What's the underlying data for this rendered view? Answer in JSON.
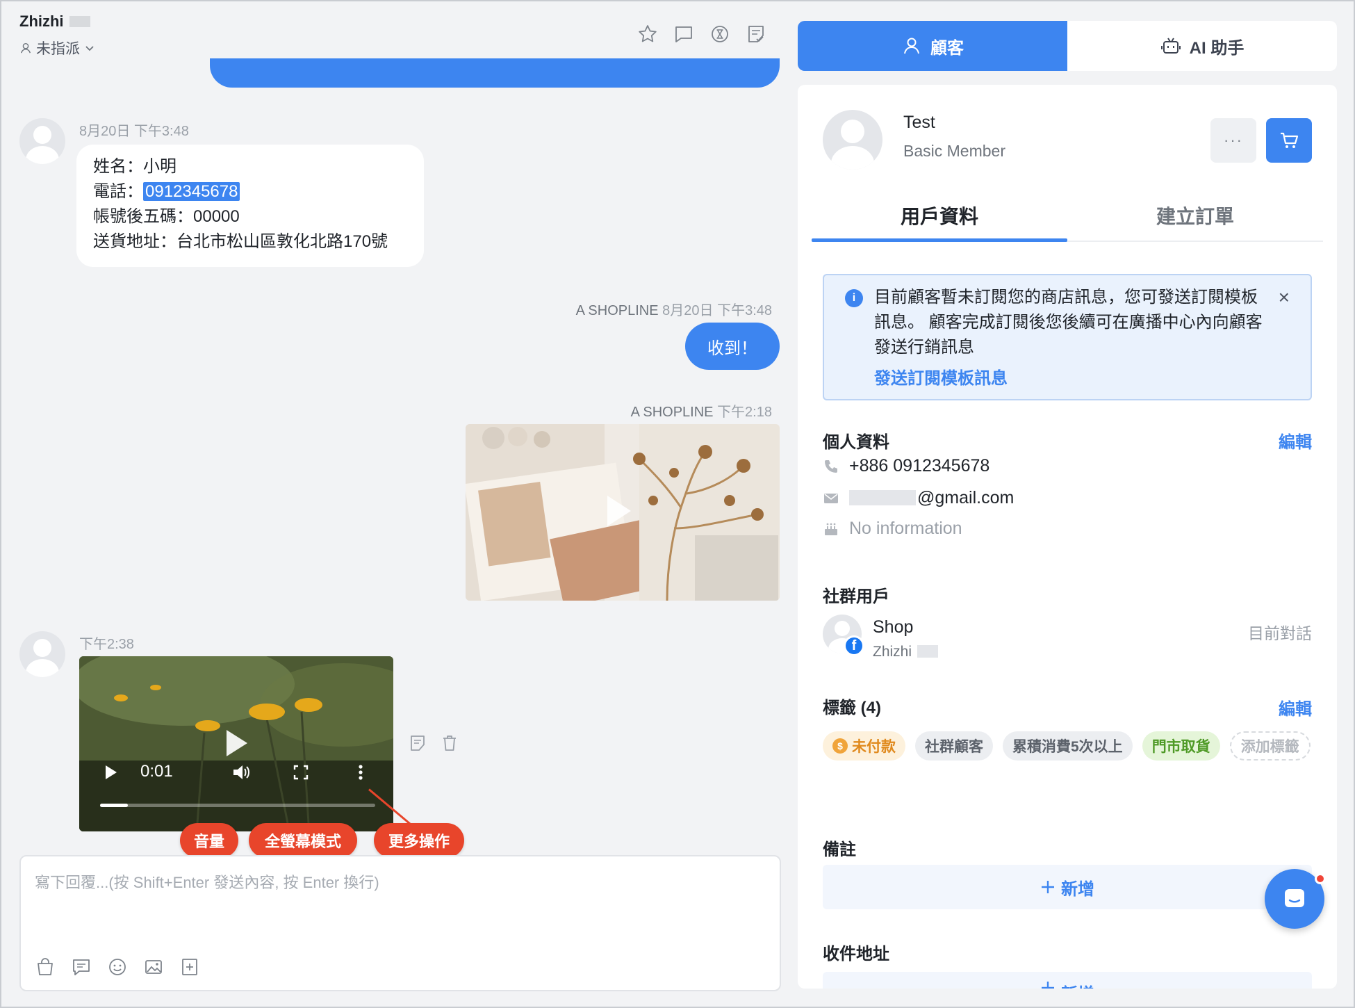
{
  "chat": {
    "contact_name": "Zhizhi",
    "assignment": "未指派",
    "messages": [
      {
        "timestamp": "8月20日 下午3:48",
        "lines": {
          "name": "姓名：小明",
          "phone_prefix": "電話：",
          "phone": "0912345678",
          "account": "帳號後五碼：00000",
          "address": "送貨地址：台北市松山區敦化北路170號"
        }
      },
      {
        "sender": "A SHOPLINE",
        "timestamp": "8月20日 下午3:48",
        "text": "收到！"
      },
      {
        "sender": "A SHOPLINE",
        "timestamp": "下午2:18"
      },
      {
        "timestamp": "下午2:38",
        "video_time": "0:01",
        "progress": 0.1
      }
    ],
    "annotations": {
      "volume": "音量",
      "fullscreen": "全螢幕模式",
      "more": "更多操作"
    },
    "composer_placeholder": "寫下回覆...(按 Shift+Enter 發送內容, 按 Enter 換行)"
  },
  "panel_tabs": {
    "customer": "顧客",
    "ai": "AI 助手"
  },
  "customer": {
    "name": "Test",
    "level": "Basic Member",
    "more": "···",
    "tabs": {
      "profile": "用戶資料",
      "create_order": "建立訂單"
    },
    "notice": {
      "text": "目前顧客暫未訂閱您的商店訊息，您可發送訂閱模板訊息。 顧客完成訂閱後您後續可在廣播中心內向顧客發送行銷訊息",
      "link": "發送訂閱模板訊息",
      "close": "×"
    },
    "personal": {
      "title": "個人資料",
      "edit": "編輯",
      "phone": "+886 0912345678",
      "email": "@gmail.com",
      "birthday": "No information"
    },
    "social": {
      "title": "社群用戶",
      "name": "Shop",
      "sub": "Zhizhi",
      "status": "目前對話",
      "fb": "f"
    },
    "tags": {
      "title": "標籤 (4)",
      "edit": "編輯",
      "items": [
        {
          "label": "未付款",
          "kind": "unpaid",
          "coin": "$"
        },
        {
          "label": "社群顧客",
          "kind": "gray"
        },
        {
          "label": "累積消費5次以上",
          "kind": "gray"
        },
        {
          "label": "門市取貨",
          "kind": "green"
        }
      ],
      "add": "添加標籤"
    },
    "notes": {
      "title": "備註",
      "add": "新增"
    },
    "address": {
      "title": "收件地址",
      "add": "新增"
    }
  },
  "colors": {
    "accent": "#3d85f0",
    "annotation": "#e8452b",
    "tag_unpaid": "#e08a1e",
    "tag_green": "#4e9a26"
  }
}
